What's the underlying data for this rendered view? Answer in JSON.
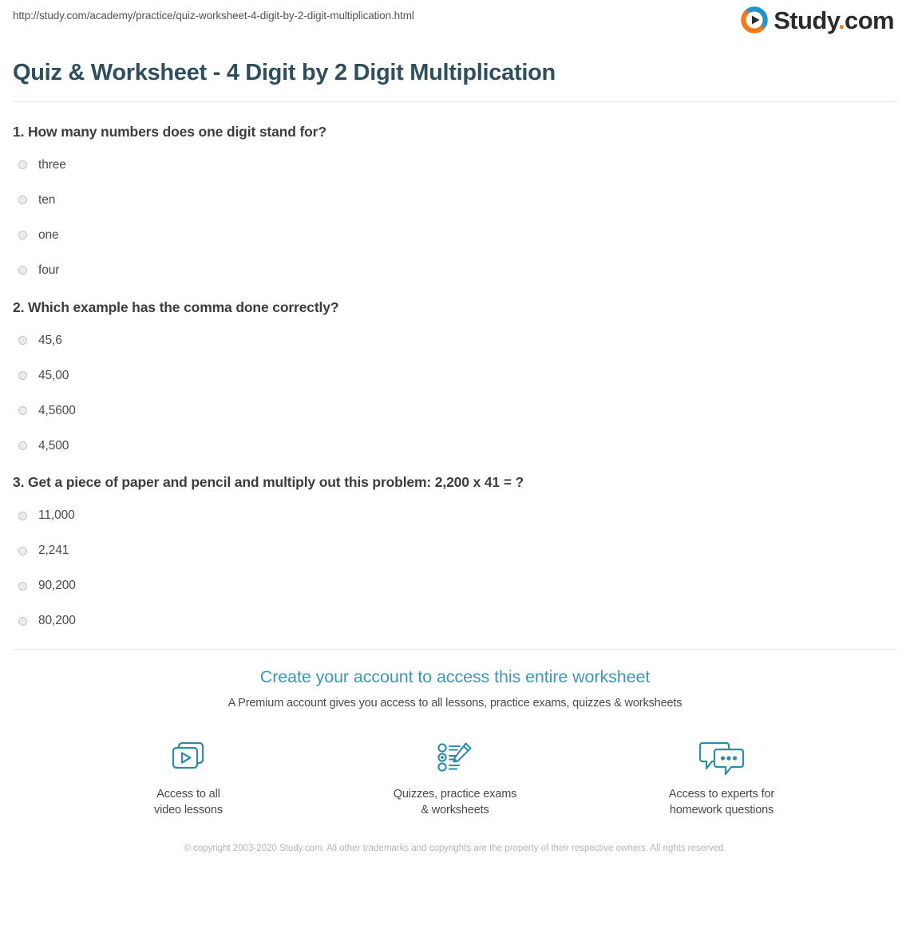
{
  "browser": {
    "url": "http://study.com/academy/practice/quiz-worksheet-4-digit-by-2-digit-multiplication.html"
  },
  "logo": {
    "name": "Study",
    "separator": ".",
    "tld": "com",
    "icon": "play-circle-icon",
    "ring_color_start": "#f07c1e",
    "ring_color_end": "#2196c9"
  },
  "page_title": "Quiz & Worksheet - 4 Digit by 2 Digit Multiplication",
  "questions": [
    {
      "text": "1. How many numbers does one digit stand for?",
      "options": [
        "three",
        "ten",
        "one",
        "four"
      ]
    },
    {
      "text": "2. Which example has the comma done correctly?",
      "options": [
        "45,6",
        "45,00",
        "4,5600",
        "4,500"
      ]
    },
    {
      "text": "3. Get a piece of paper and pencil and multiply out this problem: 2,200 x 41 = ?",
      "options": [
        "11,000",
        "2,241",
        "90,200",
        "80,200"
      ]
    }
  ],
  "cta": {
    "headline": "Create your account to access this entire worksheet",
    "subtext": "A Premium account gives you access to all lessons, practice exams, quizzes & worksheets",
    "accent_color": "#4097b4",
    "features": [
      {
        "icon": "video-lessons-icon",
        "label_line1": "Access to all",
        "label_line2": "video lessons"
      },
      {
        "icon": "quiz-checklist-pencil-icon",
        "label_line1": "Quizzes, practice exams",
        "label_line2": "& worksheets"
      },
      {
        "icon": "chat-bubbles-icon",
        "label_line1": "Access to experts for",
        "label_line2": "homework questions"
      }
    ]
  },
  "copyright": "© copyright 2003-2020 Study.com. All other trademarks and copyrights are the property of their respective owners. All rights reserved."
}
